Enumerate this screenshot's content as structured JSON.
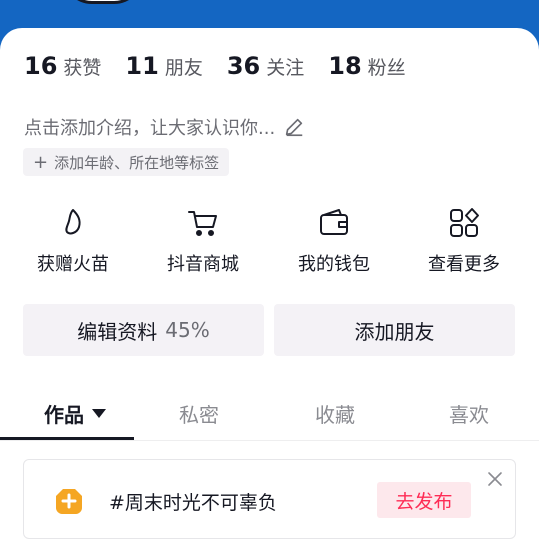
{
  "stats": [
    {
      "num": "16",
      "label": "获赞"
    },
    {
      "num": "11",
      "label": "朋友"
    },
    {
      "num": "36",
      "label": "关注"
    },
    {
      "num": "18",
      "label": "粉丝"
    }
  ],
  "bio": {
    "text": "点击添加介绍，让大家认识你...",
    "icon": "pencil-icon"
  },
  "tag_chip": {
    "label": "添加年龄、所在地等标签",
    "icon": "plus-icon"
  },
  "quick_actions": [
    {
      "label": "获赠火苗",
      "icon": "flame-icon"
    },
    {
      "label": "抖音商城",
      "icon": "cart-icon"
    },
    {
      "label": "我的钱包",
      "icon": "wallet-icon"
    },
    {
      "label": "查看更多",
      "icon": "grid-icon"
    }
  ],
  "buttons": {
    "edit_profile": "编辑资料",
    "edit_progress": "45%",
    "add_friend": "添加朋友"
  },
  "tabs": [
    {
      "label": "作品",
      "active": true
    },
    {
      "label": "私密",
      "active": false
    },
    {
      "label": "收藏",
      "active": false
    },
    {
      "label": "喜欢",
      "active": false
    }
  ],
  "suggestion_card": {
    "topic": "#周末时光不可辜负",
    "cta": "去发布",
    "icon": "plus-badge-icon"
  },
  "colors": {
    "header": "#1466c2",
    "accent": "#fe2c55",
    "badge": "#f5a623"
  }
}
